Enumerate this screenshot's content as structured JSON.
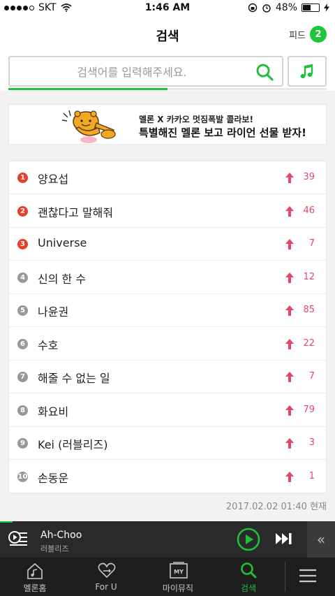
{
  "status_bar": {
    "carrier": "SKT",
    "time": "1:46 AM",
    "battery_text": "48%",
    "battery_level": 0.48
  },
  "header": {
    "title": "검색",
    "feed_label": "피드",
    "feed_count": "2"
  },
  "search": {
    "placeholder": "검색어를 입력해주세요."
  },
  "banner": {
    "line1": "멜론 X 카카오 멋짐폭발 콜라보!",
    "line2": "특별해진 멜론 보고 라이언 선물 받자!"
  },
  "chart": {
    "items": [
      {
        "rank": "1",
        "keyword": "양요섭",
        "trend": "up",
        "change": "39"
      },
      {
        "rank": "2",
        "keyword": "괜찮다고 말해줘",
        "trend": "up",
        "change": "46"
      },
      {
        "rank": "3",
        "keyword": "Universe",
        "trend": "up",
        "change": "7"
      },
      {
        "rank": "4",
        "keyword": "신의 한 수",
        "trend": "up",
        "change": "12"
      },
      {
        "rank": "5",
        "keyword": "나윤권",
        "trend": "up",
        "change": "85"
      },
      {
        "rank": "6",
        "keyword": "수호",
        "trend": "up",
        "change": "22"
      },
      {
        "rank": "7",
        "keyword": "해줄 수 없는 일",
        "trend": "up",
        "change": "7"
      },
      {
        "rank": "8",
        "keyword": "화요비",
        "trend": "up",
        "change": "79"
      },
      {
        "rank": "9",
        "keyword": "Kei (러블리즈)",
        "trend": "up",
        "change": "3"
      },
      {
        "rank": "10",
        "keyword": "손동운",
        "trend": "up",
        "change": "1"
      }
    ],
    "timestamp": "2017.02.02 01:40 현재"
  },
  "player": {
    "song": "Ah-Choo",
    "artist": "러블리즈"
  },
  "tabs": [
    {
      "label": "멜론홈",
      "icon": "melon-home-icon"
    },
    {
      "label": "For U",
      "icon": "for-u-icon"
    },
    {
      "label": "마이뮤직",
      "icon": "my-music-icon"
    },
    {
      "label": "검색",
      "icon": "search-icon"
    }
  ],
  "colors": {
    "accent": "#1fc13a",
    "rank_top": "#e8402f",
    "trend_up": "#e2476a"
  }
}
